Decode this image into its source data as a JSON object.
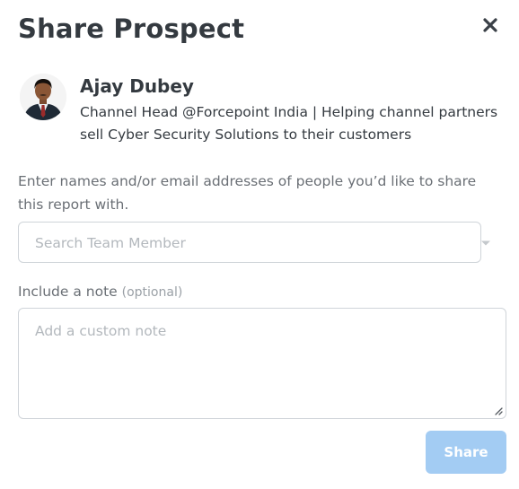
{
  "modal": {
    "title": "Share Prospect",
    "close_icon": "close-x-icon"
  },
  "prospect": {
    "name": "Ajay Dubey",
    "headline": "Channel Head @Forcepoint India | Helping channel partners sell Cyber Security Solutions to their customers",
    "avatar": "profile-photo"
  },
  "share": {
    "instructions": "Enter names and/or email addresses of people you’d like to share this report with.",
    "search_placeholder": "Search Team Member",
    "dropdown_icon": "caret-down-icon"
  },
  "note": {
    "label": "Include a note",
    "optional_label": "(optional)",
    "placeholder": "Add a custom note",
    "resize_icon": "resize-handle-icon"
  },
  "actions": {
    "share_label": "Share",
    "share_disabled": true
  },
  "colors": {
    "text_dark": "#343a40",
    "text_muted": "#6a6f75",
    "placeholder": "#b3b8bd",
    "border": "#cfd4d9",
    "share_button_disabled": "#a3ccf3"
  }
}
